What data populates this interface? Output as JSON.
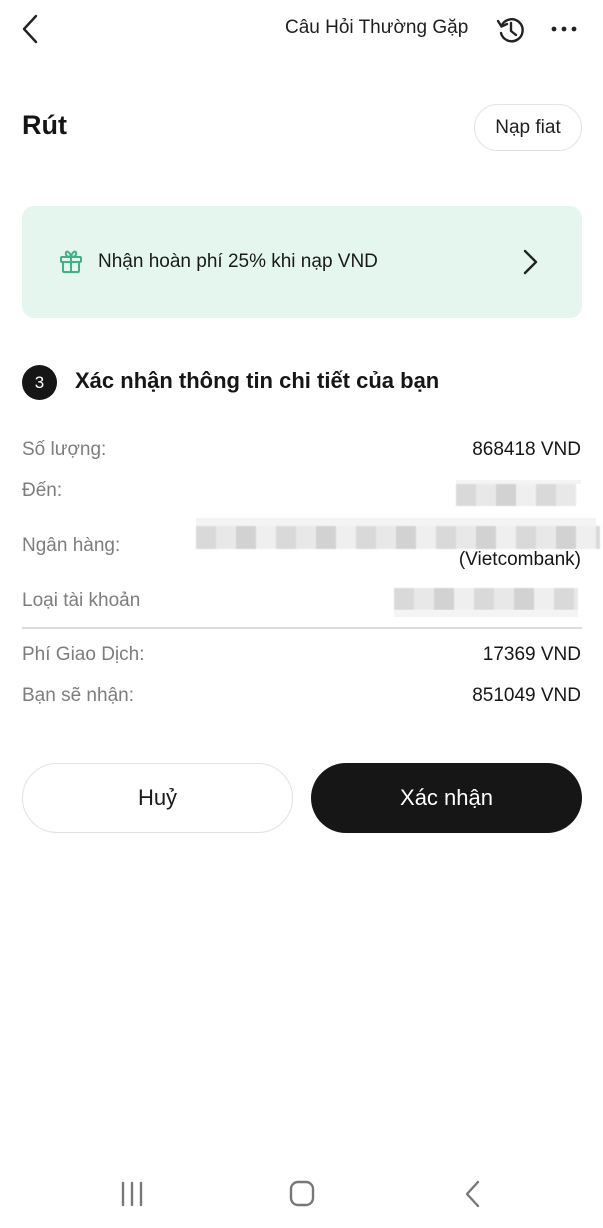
{
  "header": {
    "faq_label": "Câu Hỏi Thường Gặp",
    "icons": [
      "back-chevron-icon",
      "history-icon",
      "more-dots-icon"
    ]
  },
  "page": {
    "title": "Rút",
    "fiat_button_label": "Nạp fiat"
  },
  "promo": {
    "text": "Nhận hoàn phí 25% khi nạp VND",
    "icon": "gift-icon",
    "accent_bg": "#e5f6ef",
    "accent_icon": "#3bb28a"
  },
  "step": {
    "number": "3",
    "title": "Xác nhận thông tin chi tiết của bạn"
  },
  "details": {
    "amount_label": "Số lượng:",
    "amount_value": "868418 VND",
    "to_label": "Đến:",
    "bank_label": "Ngân hàng:",
    "bank_suffix": "(Vietcombank)",
    "account_type_label": "Loại tài khoản",
    "fee_label": "Phí Giao Dịch:",
    "fee_value": "17369 VND",
    "receive_label": "Bạn sẽ nhận:",
    "receive_value": "851049 VND"
  },
  "actions": {
    "cancel_label": "Huỷ",
    "confirm_label": "Xác nhận"
  },
  "system_nav": {
    "icons": [
      "recents-icon",
      "home-icon",
      "back-icon"
    ]
  }
}
